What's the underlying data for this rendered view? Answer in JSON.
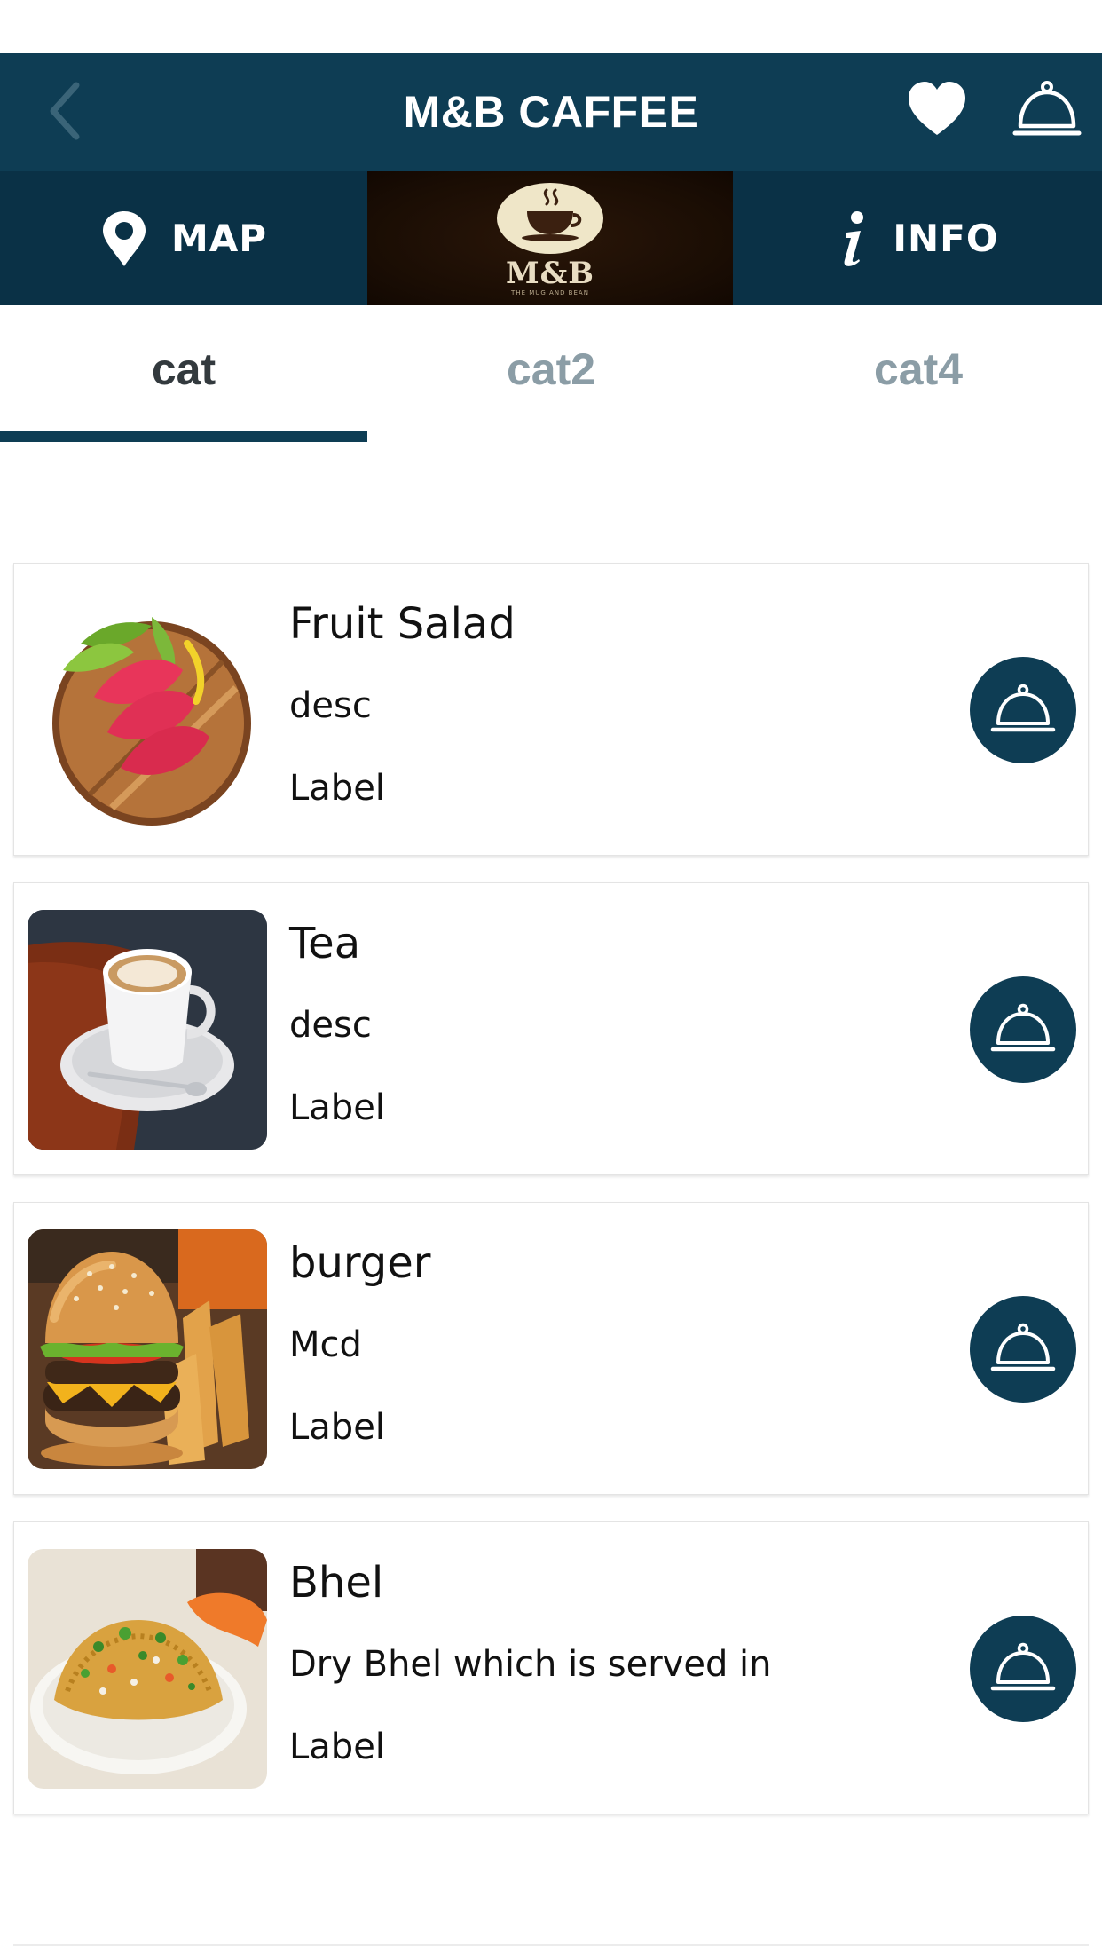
{
  "header": {
    "title": "M&B CAFFEE",
    "back_icon": "chevron-left-icon",
    "favorite_icon": "heart-icon",
    "service_icon": "service-bell-icon"
  },
  "action_bar": {
    "map_label": "MAP",
    "map_icon": "map-pin-icon",
    "logo_text": "M&B",
    "logo_tagline": "THE MUG AND BEAN",
    "info_label": "INFO",
    "info_icon": "info-icon"
  },
  "tabs": [
    {
      "label": "cat",
      "active": true
    },
    {
      "label": "cat2",
      "active": false
    },
    {
      "label": "cat4",
      "active": false
    }
  ],
  "items": [
    {
      "name": "Fruit Salad",
      "desc": "desc",
      "label": "Label",
      "image": "sashimi-plate-photo"
    },
    {
      "name": "Tea",
      "desc": "desc",
      "label": "Label",
      "image": "tea-cup-photo"
    },
    {
      "name": "burger",
      "desc": "Mcd",
      "label": "Label",
      "image": "burger-fries-photo"
    },
    {
      "name": "Bhel",
      "desc": "Dry Bhel which is served in",
      "label": "Label",
      "image": "bhel-plate-photo"
    }
  ],
  "colors": {
    "primary": "#0e3d54",
    "action_bar": "#0a3146",
    "tab_active": "#333a3e",
    "tab_inactive": "#8b9da6"
  }
}
